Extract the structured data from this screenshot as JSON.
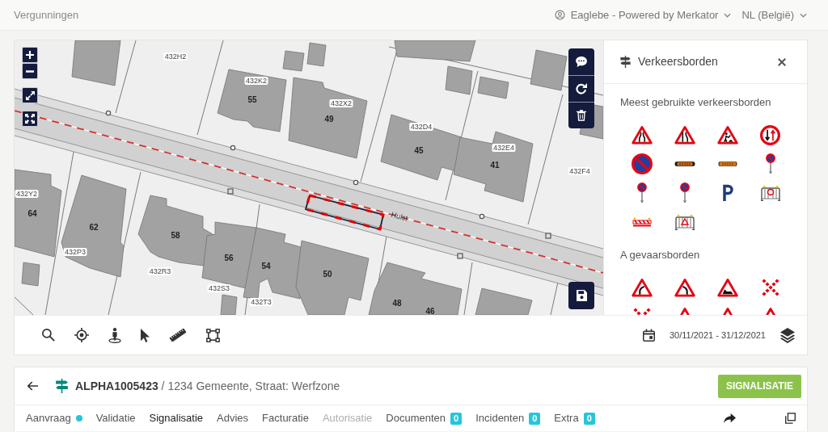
{
  "header": {
    "title": "Vergunningen",
    "account": "Eaglebe - Powered by Merkator",
    "language": "NL (België)"
  },
  "map": {
    "labels": [
      {
        "text": "432H2",
        "kind": "parcel"
      },
      {
        "text": "432K2",
        "kind": "parcel"
      },
      {
        "text": "55",
        "kind": "number"
      },
      {
        "text": "432X2",
        "kind": "parcel"
      },
      {
        "text": "49",
        "kind": "number"
      },
      {
        "text": "432D4",
        "kind": "parcel"
      },
      {
        "text": "45",
        "kind": "number"
      },
      {
        "text": "432E4",
        "kind": "parcel"
      },
      {
        "text": "41",
        "kind": "number"
      },
      {
        "text": "432F4",
        "kind": "parcel"
      },
      {
        "text": "432Y2",
        "kind": "parcel"
      },
      {
        "text": "64",
        "kind": "number"
      },
      {
        "text": "Hulst",
        "kind": "street"
      },
      {
        "text": "62",
        "kind": "number"
      },
      {
        "text": "58",
        "kind": "number"
      },
      {
        "text": "432P3",
        "kind": "parcel"
      },
      {
        "text": "56",
        "kind": "number"
      },
      {
        "text": "54",
        "kind": "number"
      },
      {
        "text": "432R3",
        "kind": "parcel"
      },
      {
        "text": "50",
        "kind": "number"
      },
      {
        "text": "432S3",
        "kind": "parcel"
      },
      {
        "text": "432T3",
        "kind": "parcel"
      },
      {
        "text": "48",
        "kind": "number"
      },
      {
        "text": "46",
        "kind": "number"
      }
    ]
  },
  "sign_panel": {
    "title": "Verkeersborden",
    "sections": [
      {
        "title": "Meest gebruikte verkeersborden",
        "signs": [
          {
            "kind": "narrowing"
          },
          {
            "kind": "narrowright"
          },
          {
            "kind": "roadworks"
          },
          {
            "kind": "oncoming"
          },
          {
            "kind": "noparking"
          },
          {
            "kind": "detour"
          },
          {
            "kind": "detourshort"
          },
          {
            "kind": "pole"
          },
          {
            "kind": "pole"
          },
          {
            "kind": "pole"
          },
          {
            "kind": "parking"
          },
          {
            "kind": "fencering"
          },
          {
            "kind": "barricade"
          },
          {
            "kind": "fencesign"
          }
        ]
      },
      {
        "title": "A gevaarsborden",
        "signs": [
          {
            "kind": "curveright"
          },
          {
            "kind": "curveleft"
          },
          {
            "kind": "ramp"
          },
          {
            "kind": "crossdots"
          },
          {
            "kind": "crossdots"
          },
          {
            "kind": "warning"
          },
          {
            "kind": "warning"
          },
          {
            "kind": "warning"
          }
        ]
      }
    ]
  },
  "toolbar": {
    "date_range": "30/11/2021 - 31/12/2021"
  },
  "dossier": {
    "title": "**ALPHA1005423** / 1234 Gemeente, Straat: Werfzone",
    "action": "SIGNALISATIE",
    "tabs": [
      {
        "label": "Aanvraag",
        "selected": false,
        "disabled": false,
        "indicator": true
      },
      {
        "label": "Validatie",
        "selected": false,
        "disabled": false,
        "indicator": false
      },
      {
        "label": "Signalisatie",
        "selected": true,
        "disabled": false,
        "indicator": false
      },
      {
        "label": "Advies",
        "selected": false,
        "disabled": false,
        "indicator": false
      },
      {
        "label": "Facturatie",
        "selected": false,
        "disabled": false,
        "indicator": false
      },
      {
        "label": "Autorisatie",
        "selected": false,
        "disabled": true,
        "indicator": false
      },
      {
        "label": "Documenten",
        "selected": false,
        "disabled": false,
        "indicator": false,
        "badge": "0"
      },
      {
        "label": "Incidenten",
        "selected": false,
        "disabled": false,
        "indicator": false,
        "badge": "0"
      },
      {
        "label": "Extra",
        "selected": false,
        "disabled": false,
        "indicator": false,
        "badge": "0"
      }
    ]
  }
}
